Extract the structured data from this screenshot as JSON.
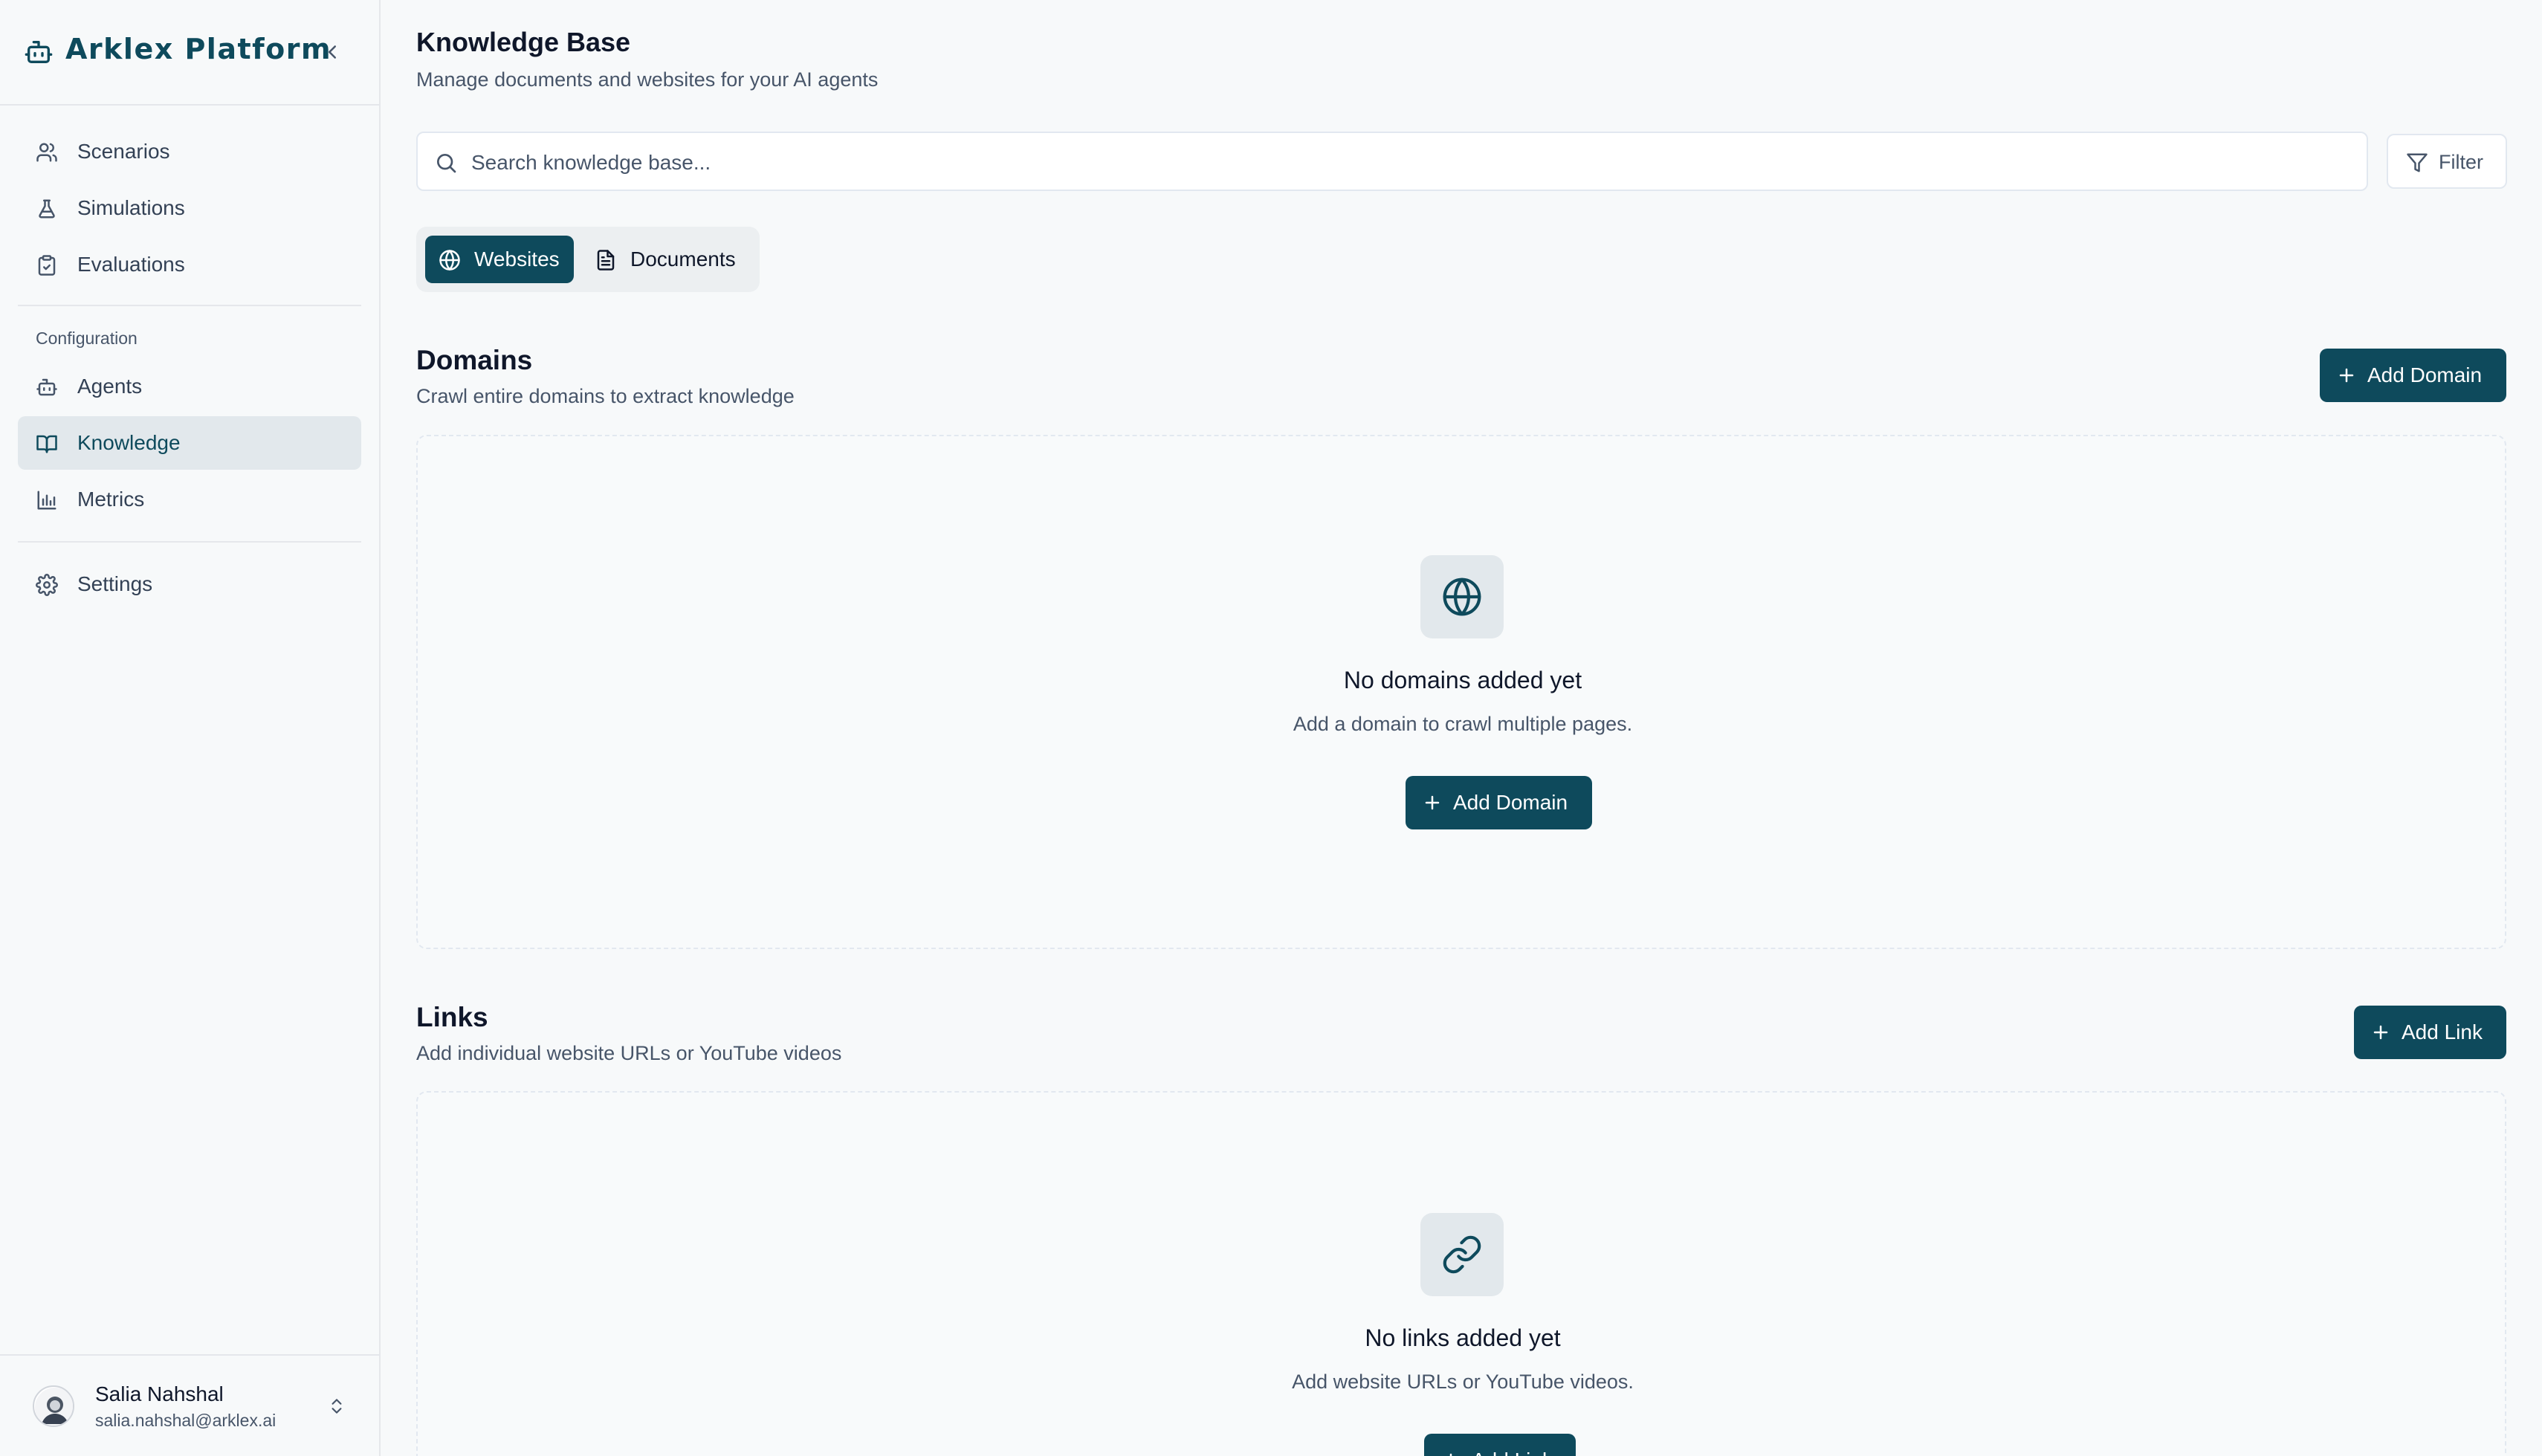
{
  "sidebar": {
    "brand": "Arklex Platform",
    "nav": [
      {
        "label": "Scenarios",
        "icon": "users-icon"
      },
      {
        "label": "Simulations",
        "icon": "flask-icon"
      },
      {
        "label": "Evaluations",
        "icon": "clipboard-check-icon"
      }
    ],
    "config_label": "Configuration",
    "config_nav": [
      {
        "label": "Agents",
        "icon": "bot-icon"
      },
      {
        "label": "Knowledge",
        "icon": "book-icon",
        "active": true
      },
      {
        "label": "Metrics",
        "icon": "bar-chart-icon"
      }
    ],
    "settings_label": "Settings",
    "user": {
      "name": "Salia Nahshal",
      "email": "salia.nahshal@arklex.ai"
    }
  },
  "header": {
    "title": "Knowledge Base",
    "subtitle": "Manage documents and websites for your AI agents"
  },
  "search": {
    "placeholder": "Search knowledge base...",
    "value": ""
  },
  "filter_label": "Filter",
  "tabs": [
    {
      "label": "Websites",
      "active": true
    },
    {
      "label": "Documents",
      "active": false
    }
  ],
  "domains": {
    "title": "Domains",
    "description": "Crawl entire domains to extract knowledge",
    "add_label": "Add Domain",
    "empty_title": "No domains added yet",
    "empty_desc": "Add a domain to crawl multiple pages.",
    "empty_button": "Add Domain"
  },
  "links": {
    "title": "Links",
    "description": "Add individual website URLs or YouTube videos",
    "add_label": "Add Link",
    "empty_title": "No links added yet",
    "empty_desc": "Add website URLs or YouTube videos.",
    "empty_button": "Add Link"
  },
  "colors": {
    "accent": "#0e4a5c",
    "background": "#f7f9fa",
    "muted_text": "#475569"
  }
}
